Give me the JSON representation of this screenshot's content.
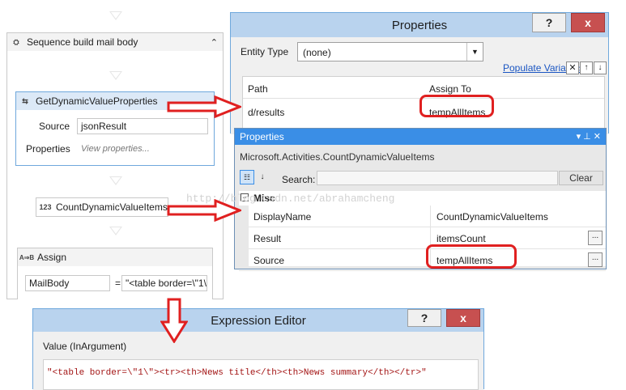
{
  "workflow": {
    "sequence_title": "Sequence build mail body",
    "get_activity": {
      "title": "GetDynamicValueProperties",
      "source_label": "Source",
      "source_value": "jsonResult",
      "properties_label": "Properties",
      "properties_link": "View properties..."
    },
    "count_activity": {
      "title": "CountDynamicValueItems"
    },
    "assign_activity": {
      "title": "Assign",
      "to_value": "MailBody",
      "equals": "=",
      "value": "\"<table border=\\\"1\\\""
    }
  },
  "properties_dialog": {
    "title": "Properties",
    "help_button": "?",
    "close_button": "x",
    "entity_type_label": "Entity Type",
    "entity_type_value": "(none)",
    "populate_link": "Populate Variables",
    "columns": [
      "Path",
      "Assign To"
    ],
    "rows": [
      {
        "path": "d/results",
        "assign_to": "tempAllItems"
      }
    ]
  },
  "properties_panel": {
    "title": "Properties",
    "pin_glyph": "▾ ⊥ ✕",
    "type_name": "Microsoft.Activities.CountDynamicValueItems",
    "search_label": "Search:",
    "clear_button": "Clear",
    "category": "Misc",
    "rows": [
      {
        "name": "DisplayName",
        "value": "CountDynamicValueItems",
        "has_button": false
      },
      {
        "name": "Result",
        "value": "itemsCount",
        "has_button": true
      },
      {
        "name": "Source",
        "value": "tempAllItems",
        "has_button": true
      }
    ],
    "ellipsis": "..."
  },
  "expression_editor": {
    "title": "Expression Editor",
    "help_button": "?",
    "close_button": "x",
    "value_label": "Value (InArgument)",
    "expression": "\"<table border=\\\"1\\\"><tr><th>News title</th><th>News summary</th></tr>\""
  },
  "watermark": "http://blog.csdn.net/abrahamcheng",
  "colors": {
    "accent_blue": "#3a8ee6",
    "annotation_red": "#e02020",
    "dialog_border": "#6fa8dc"
  }
}
